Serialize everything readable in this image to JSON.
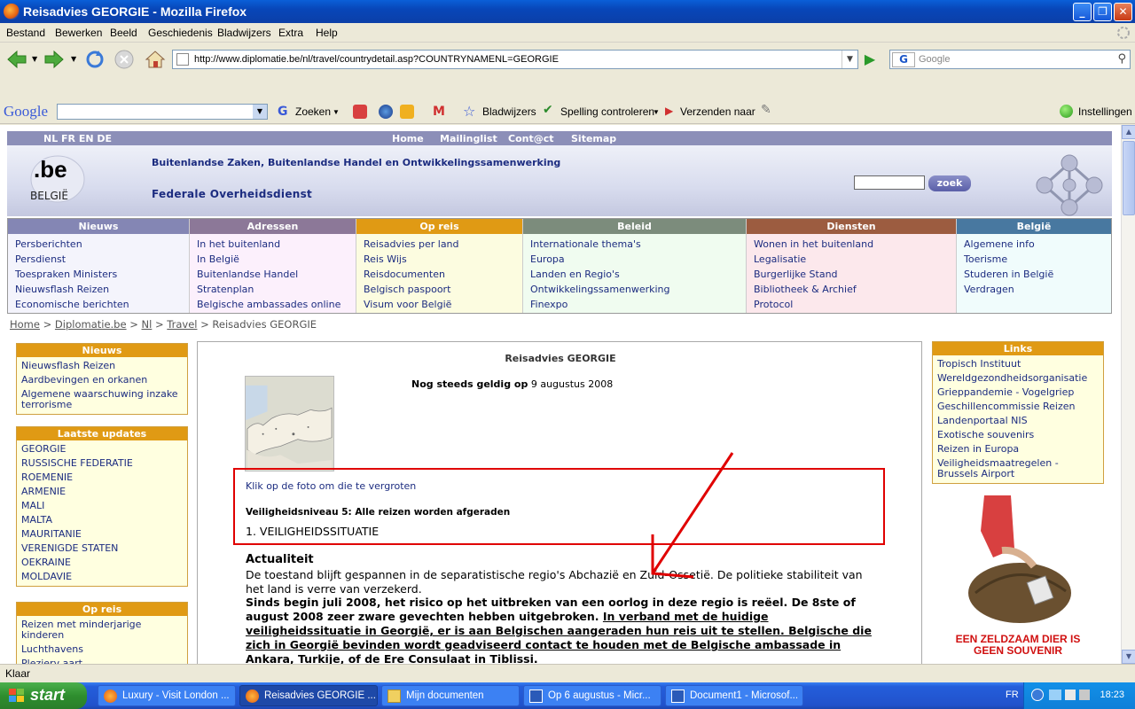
{
  "window": {
    "title": "Reisadvies GEORGIE - Mozilla Firefox"
  },
  "menu": [
    "Bestand",
    "Bewerken",
    "Beeld",
    "Geschiedenis",
    "Bladwijzers",
    "Extra",
    "Help"
  ],
  "nav": {
    "url": "http://www.diplomatie.be/nl/travel/countrydetail.asp?COUNTRYNAMENL=GEORGIE",
    "search_placeholder": "Google"
  },
  "google_toolbar": {
    "logo": "Google",
    "zoeken": "Zoeken",
    "bladwijzers": "Bladwijzers",
    "spelling": "Spelling controleren",
    "verzenden": "Verzenden naar",
    "instellingen": "Instellingen"
  },
  "site": {
    "langs": "NL  FR  EN  DE",
    "top_links": [
      "Home",
      "Mailinglist",
      "Cont@ct",
      "Sitemap"
    ],
    "logo_text": ".be",
    "logo_sub": "BELGIË",
    "line1": "Buitenlandse Zaken, Buitenlandse Handel en Ontwikkelingssamenwerking",
    "line2": "Federale Overheidsdienst",
    "search_button": "zoek"
  },
  "columns": [
    {
      "title": "Nieuws",
      "color": "#8486b4",
      "bg": "#f4f4fc",
      "items": [
        "Persberichten",
        "Persdienst",
        "Toespraken Ministers",
        "Nieuwsflash Reizen",
        "Economische berichten"
      ]
    },
    {
      "title": "Adressen",
      "color": "#8c7898",
      "bg": "#fcf0fc",
      "items": [
        "In het buitenland",
        "In België",
        "Buitenlandse Handel",
        "Stratenplan",
        "Belgische ambassades online"
      ]
    },
    {
      "title": "Op reis",
      "color": "#e09a14",
      "bg": "#fcfce0",
      "items": [
        "Reisadvies per land",
        "Reis Wijs",
        "Reisdocumenten",
        "Belgisch paspoort",
        "Visum voor België"
      ]
    },
    {
      "title": "Beleid",
      "color": "#7c8c7c",
      "bg": "#f0fcf0",
      "items": [
        "Internationale thema's",
        "Europa",
        "Landen en Regio's",
        "Ontwikkelingssamenwerking",
        "Finexpo"
      ]
    },
    {
      "title": "Diensten",
      "color": "#9c5c40",
      "bg": "#fce8ec",
      "items": [
        "Wonen in het buitenland",
        "Legalisatie",
        "Burgerlijke Stand",
        "Bibliotheek & Archief",
        "Protocol"
      ]
    },
    {
      "title": "België",
      "color": "#4878a0",
      "bg": "#f0fcfc",
      "items": [
        "Algemene info",
        "Toerisme",
        "Studeren in België",
        "Verdragen"
      ]
    }
  ],
  "breadcrumb": {
    "home": "Home",
    "sep": ">",
    "diplomatie": "Diplomatie.be",
    "nl": "Nl",
    "travel": "Travel",
    "current": "Reisadvies GEORGIE"
  },
  "left": {
    "nieuws_title": "Nieuws",
    "nieuws": [
      "Nieuwsflash Reizen",
      "Aardbevingen en orkanen",
      "Algemene waarschuwing inzake terrorisme"
    ],
    "updates_title": "Laatste updates",
    "updates": [
      "GEORGIE",
      "RUSSISCHE FEDERATIE",
      "ROEMENIE",
      "ARMENIE",
      "MALI",
      "MALTA",
      "MAURITANIE",
      "VERENIGDE STATEN",
      "OEKRAINE",
      "MOLDAVIE"
    ],
    "opreis_title": "Op reis",
    "opreis": [
      "Reizen met minderjarige kinderen",
      "Luchthavens",
      "Plezierv aart"
    ]
  },
  "right": {
    "links_title": "Links",
    "links": [
      "Tropisch Instituut",
      "Wereldgezondheidsorganisatie",
      "Grieppandemie - Vogelgriep",
      "Geschillencommissie Reizen",
      "Landenportaal NIS",
      "Exotische souvenirs",
      "Reizen in Europa",
      "Veiligheidsmaatregelen - Brussels Airport"
    ],
    "ad_caption": "EEN ZELDZAAM DIER IS GEEN SOUVENIR"
  },
  "content": {
    "title": "Reisadvies GEORGIE",
    "valid_label": "Nog steeds geldig op",
    "valid_date": "9 augustus 2008",
    "klik": "Klik op de foto om die te vergroten",
    "level": "Veiligheidsniveau 5: Alle reizen worden afgeraden",
    "section": "1. VEILIGHEIDSSITUATIE",
    "actualiteit": "Actualiteit",
    "p1": "De toestand blijft gespannen in de separatistische regio's Abchazië en Zuid-Ossetië. De politieke stabiliteit van het land is verre van verzekerd.",
    "p2_a": "Sinds begin juli 2008, het risico op het uitbreken van een oorlog in deze regio is reëel. De 8ste of august 2008 zeer zware gevechten hebben uitgebroken. ",
    "p2_b": "In verband met de huidige veiligheidssituatie in Georgië, er is aan Belgischen aangeraden hun reis uit te stellen. Belgische die zich in Georgië bevinden wordt geadviseerd contact te houden met de Belgische ambassade in Ankara, Turkije, of de Ere Consulaat in Tiblissi."
  },
  "status": "Klaar",
  "taskbar": {
    "start": "start",
    "tasks": [
      "Luxury - Visit London ...",
      "Reisadvies GEORGIE ...",
      "Mijn documenten",
      "Op 6 augustus - Micr...",
      "Document1 - Microsof..."
    ],
    "lang": "FR",
    "time": "18:23"
  },
  "colors": {
    "accent_red": "#e00000",
    "brand_blue": "#1c2c80",
    "orange": "#e09a14"
  }
}
